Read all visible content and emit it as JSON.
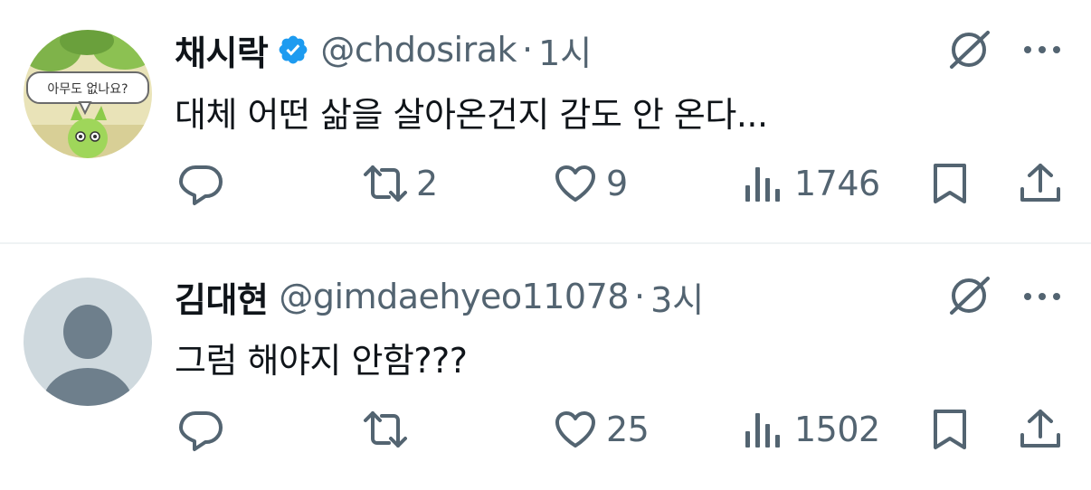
{
  "tweets": [
    {
      "display_name": "채시락",
      "verified": true,
      "handle": "@chdosirak",
      "separator": "·",
      "time": "1시",
      "text": "대체 어떤 삶을 살아온건지 감도 안 온다...",
      "avatar_caption": "아무도 없나요?",
      "replies": "",
      "reposts": "2",
      "likes": "9",
      "views": "1746"
    },
    {
      "display_name": "김대현",
      "verified": false,
      "handle": "@gimdaehyeo11078",
      "separator": "·",
      "time": "3시",
      "text": "그럼 해야지 안함???",
      "replies": "",
      "reposts": "",
      "likes": "25",
      "views": "1502"
    }
  ],
  "icons": {
    "verified": "verified-badge-icon",
    "grok": "grok-icon",
    "more": "more-dots-icon",
    "reply": "reply-icon",
    "repost": "repost-icon",
    "like": "heart-icon",
    "views": "views-bar-icon",
    "bookmark": "bookmark-icon",
    "share": "share-icon"
  },
  "colors": {
    "text_primary": "#0f1419",
    "text_secondary": "#536471",
    "verified_blue": "#1d9bf0",
    "divider": "#eff3f4",
    "default_avatar_bg": "#cfd9de",
    "default_avatar_fg": "#6e7f8c"
  }
}
